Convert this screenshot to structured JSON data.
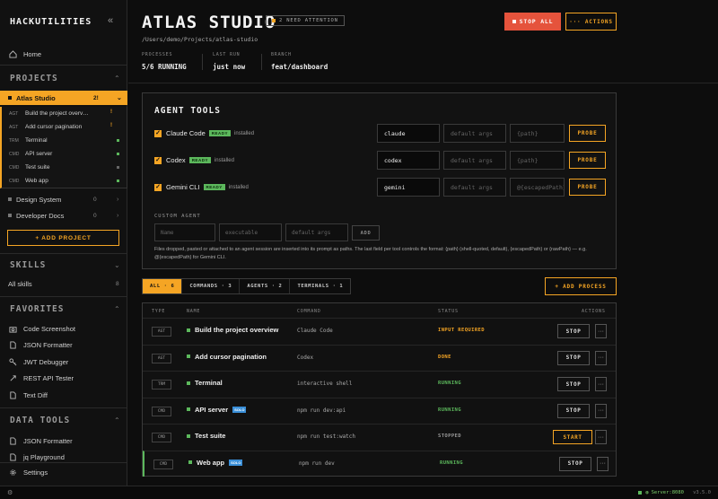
{
  "sidebar": {
    "brand": "HACKUTILITIES",
    "home": "Home",
    "projects_heading": "PROJECTS",
    "projects": [
      {
        "name": "Atlas Studio",
        "count": "2!",
        "active": true
      },
      {
        "name": "Design System",
        "count": "0"
      },
      {
        "name": "Developer Docs",
        "count": "0"
      }
    ],
    "processes": [
      {
        "type": "AGT",
        "name": "Build the project overv…",
        "dot": "!",
        "dot_color": "#f5a524"
      },
      {
        "type": "AGT",
        "name": "Add cursor pagination",
        "dot": "!",
        "dot_color": "#f5a524"
      },
      {
        "type": "TRM",
        "name": "Terminal",
        "dot": "",
        "dot_color": "#5cb85c"
      },
      {
        "type": "CMD",
        "name": "API server",
        "dot": "",
        "dot_color": "#5cb85c"
      },
      {
        "type": "CMD",
        "name": "Test suite",
        "dot": "",
        "dot_color": "#666666"
      },
      {
        "type": "CMD",
        "name": "Web app",
        "dot": "",
        "dot_color": "#5cb85c"
      }
    ],
    "add_project": "+ ADD PROJECT",
    "skills_heading": "SKILLS",
    "all_skills": "All skills",
    "all_skills_count": "8",
    "favorites_heading": "FAVORITES",
    "favorites": [
      {
        "label": "Code Screenshot",
        "icon": "camera-icon"
      },
      {
        "label": "JSON Formatter",
        "icon": "document-icon"
      },
      {
        "label": "JWT Debugger",
        "icon": "key-icon"
      },
      {
        "label": "REST API Tester",
        "icon": "rocket-icon"
      },
      {
        "label": "Text Diff",
        "icon": "diff-icon"
      }
    ],
    "datatools_heading": "DATA TOOLS",
    "datatools": [
      {
        "label": "JSON Formatter",
        "icon": "document-icon"
      },
      {
        "label": "jq Playground",
        "icon": "document-icon"
      }
    ],
    "settings": "Settings"
  },
  "header": {
    "title": "ATLAS STUDIO",
    "attention": "2 NEED ATTENTION",
    "path": "/Users/demo/Projects/atlas-studio",
    "meta": [
      {
        "label": "PROCESSES",
        "value": "5/6 RUNNING"
      },
      {
        "label": "LAST RUN",
        "value": "just now"
      },
      {
        "label": "BRANCH",
        "value": "feat/dashboard"
      }
    ],
    "stop_all": "STOP ALL",
    "actions": "··· ACTIONS"
  },
  "agent_tools": {
    "heading": "AGENT TOOLS",
    "tools": [
      {
        "name": "Claude Code",
        "badge": "READY",
        "status": "installed",
        "cmd": "claude",
        "args_placeholder": "default args",
        "path_placeholder": "{path}",
        "probe": "PROBE"
      },
      {
        "name": "Codex",
        "badge": "READY",
        "status": "installed",
        "cmd": "codex",
        "args_placeholder": "default args",
        "path_placeholder": "{path}",
        "probe": "PROBE"
      },
      {
        "name": "Gemini CLI",
        "badge": "READY",
        "status": "installed",
        "cmd": "gemini",
        "args_placeholder": "default args",
        "path_placeholder": "@{escapedPath}",
        "probe": "PROBE"
      }
    ],
    "custom_heading": "CUSTOM AGENT",
    "custom_name_placeholder": "Name",
    "custom_exec_placeholder": "executable",
    "custom_args_placeholder": "default args",
    "custom_add": "ADD",
    "note": "Files dropped, pasted or attached to an agent session are inserted into its prompt as paths. The last field per tool controls the format: {path} (shell-quoted, default), {escapedPath} or {rawPath} — e.g. @{escapedPath} for Gemini CLI."
  },
  "filters": {
    "tabs": [
      "ALL · 6",
      "COMMANDS · 3",
      "AGENTS · 2",
      "TERMINALS · 1"
    ],
    "add_process": "+ ADD PROCESS"
  },
  "table": {
    "headers": [
      "TYPE",
      "NAME",
      "COMMAND",
      "STATUS",
      "ACTIONS"
    ],
    "rows": [
      {
        "type": "AGT",
        "name": "Build the project overview",
        "solo": "",
        "command": "Claude Code",
        "status": "INPUT REQUIRED",
        "status_color": "#f5a524",
        "action": "STOP",
        "more": "···"
      },
      {
        "type": "AGT",
        "name": "Add cursor pagination",
        "solo": "",
        "command": "Codex",
        "status": "DONE",
        "status_color": "#f5a524",
        "action": "STOP",
        "more": "···"
      },
      {
        "type": "TRM",
        "name": "Terminal",
        "solo": "",
        "command": "interactive shell",
        "status": "RUNNING",
        "status_color": "#5cb85c",
        "action": "STOP",
        "more": "···"
      },
      {
        "type": "CMD",
        "name": "API server",
        "solo": "SOLO",
        "command": "npm run dev:api",
        "status": "RUNNING",
        "status_color": "#5cb85c",
        "action": "STOP",
        "more": "···"
      },
      {
        "type": "CMD",
        "name": "Test suite",
        "solo": "",
        "command": "npm run test:watch",
        "status": "STOPPED",
        "status_color": "#9a9a9a",
        "action": "START",
        "more": "···"
      },
      {
        "type": "CMD",
        "name": "Web app",
        "solo": "SOLO",
        "command": "npm run dev",
        "status": "RUNNING",
        "status_color": "#5cb85c",
        "action": "STOP",
        "more": "···"
      }
    ]
  },
  "footer": {
    "server": "Server:8080",
    "version": "v3.5.0"
  }
}
